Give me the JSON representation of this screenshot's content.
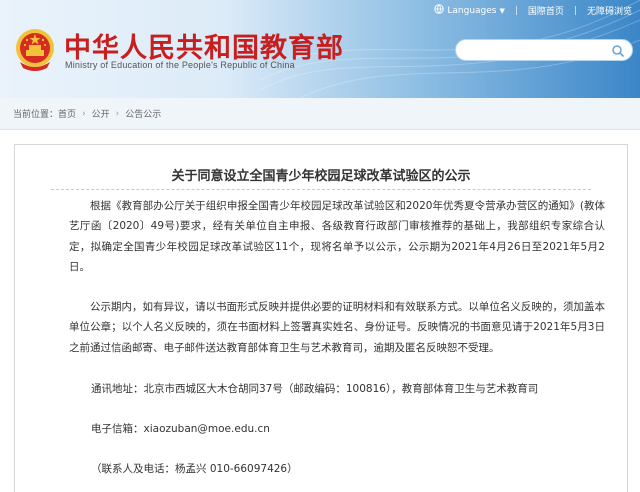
{
  "header": {
    "topbar": {
      "languages": "Languages",
      "lang_arrow": "▼",
      "old_site": "国際首页",
      "accessibility": "无障碍浏览"
    },
    "title": "中华人民共和国教育部",
    "subtitle": "Ministry of Education of the People's Republic of China",
    "search": {
      "placeholder": ""
    }
  },
  "breadcrumb": {
    "label": "当前位置：",
    "items": [
      "首页",
      "公开",
      "公告公示"
    ],
    "separator": "›"
  },
  "article": {
    "title": "关于同意设立全国青少年校园足球改革试验区的公示",
    "paragraphs": [
      "根据《教育部办公厅关于组织申报全国青少年校园足球改革试验区和2020年优秀夏令营承办营区的通知》(教体艺厅函〔2020〕49号)要求，经有关单位自主申报、各级教育行政部门审核推荐的基础上，我部组织专家综合认定，拟确定全国青少年校园足球改革试验区11个，现将名单予以公示，公示期为2021年4月26日至2021年5月2日。",
      "公示期内，如有异议，请以书面形式反映并提供必要的证明材料和有效联系方式。以单位名义反映的，须加盖本单位公章；以个人名义反映的，须在书面材料上签署真实姓名、身份证号。反映情况的书面意见请于2021年5月3日之前通过信函邮寄、电子邮件送达教育部体育卫生与艺术教育司，逾期及匿名反映恕不受理。"
    ],
    "address": "通讯地址：北京市西城区大木仓胡同37号（邮政编码：100816），教育部体育卫生与艺术教育司",
    "email": "电子信箱：xiaozuban@moe.edu.cn",
    "contact": "（联系人及电话：杨孟兴 010-66097426）"
  },
  "colors": {
    "title_red": "#c81e1e",
    "header_blue": "#3b86c8"
  }
}
